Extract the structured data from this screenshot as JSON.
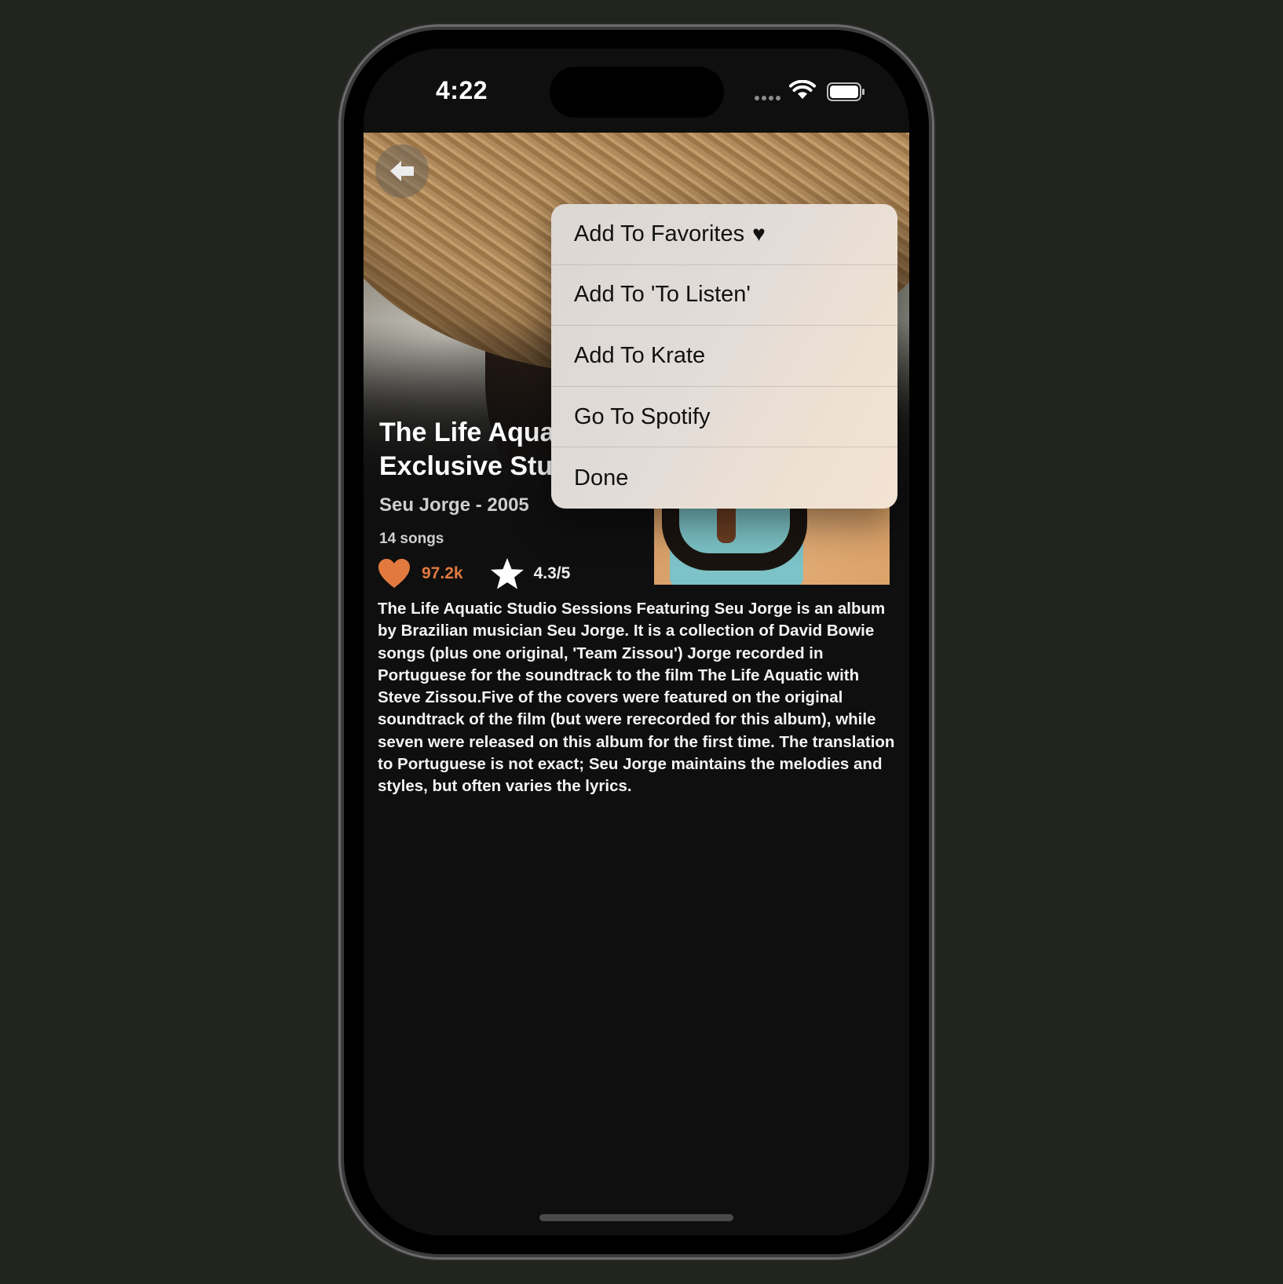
{
  "status_bar": {
    "time": "4:22"
  },
  "album": {
    "title": "The Life Aqua\nExclusive Stu",
    "artist_year": "Seu Jorge - 2005",
    "song_count": "14 songs",
    "likes": "97.2k",
    "rating": "4.3/5",
    "description": "The Life Aquatic Studio Sessions Featuring Seu Jorge is an album by Brazilian musician Seu Jorge. It is a collection of David Bowie songs (plus one original, 'Team Zissou') Jorge recorded in Portuguese for the soundtrack to the film The Life Aquatic with Steve Zissou.Five of the covers were featured on the original soundtrack of the film (but were rerecorded for this album), while seven were released on this album for the first time. The translation to Portuguese is not exact; Seu Jorge maintains the melodies and styles, but often varies the lyrics."
  },
  "menu": {
    "items": [
      {
        "label": "Add To Favorites",
        "icon": "heart-icon"
      },
      {
        "label": "Add To 'To Listen'"
      },
      {
        "label": "Add To Krate"
      },
      {
        "label": "Go To Spotify"
      },
      {
        "label": "Done"
      }
    ]
  },
  "colors": {
    "accent": "#e27a3f",
    "background": "#0f0f0f",
    "menu_background": "#e2dcd8"
  },
  "icons": {
    "back": "back-arrow-icon",
    "like": "heart-icon",
    "rating": "star-icon",
    "wifi": "wifi-icon",
    "battery": "battery-icon"
  }
}
